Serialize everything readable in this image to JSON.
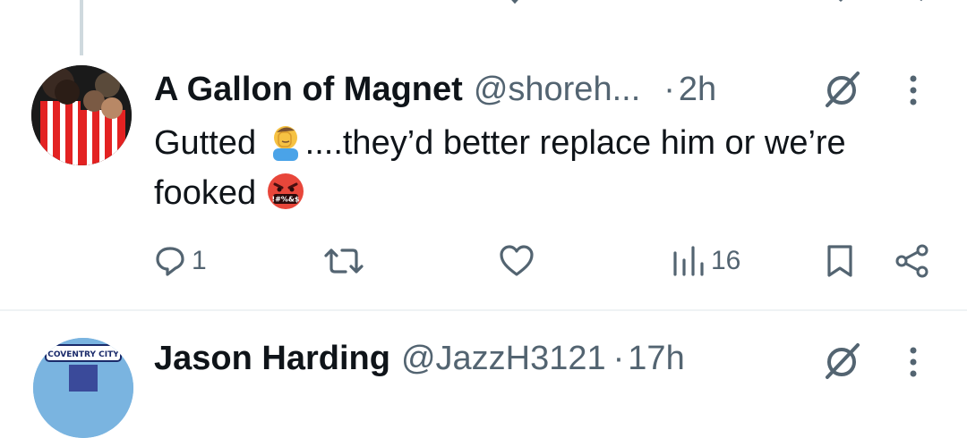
{
  "tweet": {
    "author_name": "A Gallon of Magnet",
    "author_handle": "@shoreh...",
    "separator": "·",
    "time": "2h",
    "text_part1": "Gutted ",
    "emoji1": "facepalm",
    "text_part2": "....they’d better replace him or we’re fooked ",
    "emoji2": "face-with-symbols-on-mouth",
    "emoji2_text": "!#%&$",
    "replies": "1",
    "views": "16"
  },
  "next_tweet": {
    "author_name": "Jason Harding",
    "author_handle": "@JazzH3121",
    "separator": "·",
    "time": "17h",
    "avatar_text": "COVENTRY CITY"
  },
  "colors": {
    "text_primary": "#0f1419",
    "text_secondary": "#536471",
    "divider": "#eff3f4",
    "thread_line": "#cfd9de"
  }
}
